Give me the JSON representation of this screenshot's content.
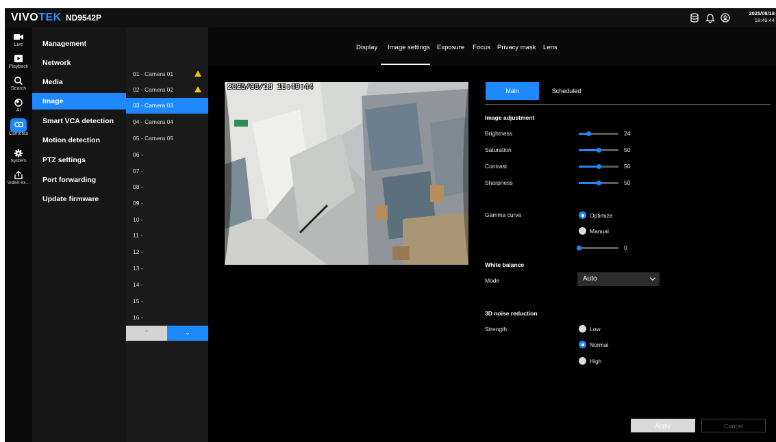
{
  "header": {
    "brand_left": "VIVO",
    "brand_right": "TEK",
    "model": "ND9542P",
    "date": "2025/08/18",
    "time": "18:49:44"
  },
  "rail": [
    {
      "label": "Live",
      "icon": "video-camera-icon"
    },
    {
      "label": "Playback",
      "icon": "playback-icon"
    },
    {
      "label": "Search",
      "icon": "search-icon"
    },
    {
      "label": "AI",
      "icon": "ai-icon"
    },
    {
      "label": "Cameras",
      "icon": "cameras-icon"
    },
    {
      "label": "System",
      "icon": "gear-icon"
    },
    {
      "label": "Video ex...",
      "icon": "export-icon"
    }
  ],
  "menu": [
    "Management",
    "Network",
    "Media",
    "Image",
    "Smart VCA detection",
    "Motion detection",
    "PTZ settings",
    "Port forwarding",
    "Update firmware"
  ],
  "cameras": [
    "01 - Camera 01",
    "02 - Camera 02",
    "03 - Camera 03",
    "04 - Camera 04",
    "05 - Camera 05",
    "06 -",
    "07 -",
    "08 -",
    "09 -",
    "10 -",
    "11 -",
    "12 -",
    "13 -",
    "14 -",
    "15 -",
    "16 -"
  ],
  "tabs": [
    "Display",
    "Image settings",
    "Exposure",
    "Focus",
    "Privacy mask",
    "Lens"
  ],
  "preview": {
    "timestamp": "2025/08/18 18:49:44"
  },
  "subtabs": {
    "main": "Main",
    "scheduled": "Scheduled"
  },
  "image_adjustment": {
    "title": "Image adjustment",
    "brightness": {
      "label": "Brightness",
      "value": "24",
      "fraction": 0.24
    },
    "saturation": {
      "label": "Saturation",
      "value": "50",
      "fraction": 0.5
    },
    "contrast": {
      "label": "Contrast",
      "value": "50",
      "fraction": 0.5
    },
    "sharpness": {
      "label": "Sharpness",
      "value": "50",
      "fraction": 0.5
    }
  },
  "gamma": {
    "label": "Gamma curve",
    "optimize": "Optimize",
    "manual": "Manual",
    "value": "0",
    "fraction": 0.0,
    "selected": "Optimize"
  },
  "white_balance": {
    "title": "White balance",
    "mode_label": "Mode",
    "mode_value": "Auto"
  },
  "noise_reduction": {
    "title": "3D noise reduction",
    "strength_label": "Strength",
    "low": "Low",
    "normal": "Normal",
    "high": "High",
    "selected": "Normal"
  },
  "buttons": {
    "apply": "Apply",
    "cancel": "Cancel"
  },
  "colors": {
    "accent": "#1e88ff",
    "warning": "#f5c518",
    "background": "#000000"
  }
}
